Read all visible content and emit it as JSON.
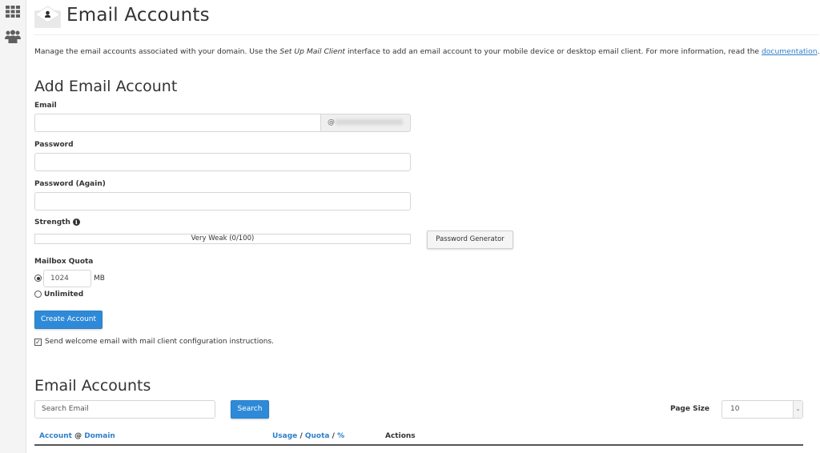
{
  "sidebar": {
    "icons": [
      "apps-grid-icon",
      "users-icon"
    ]
  },
  "header": {
    "icon": "email-envelope-icon",
    "title": "Email Accounts"
  },
  "intro": {
    "before": "Manage the email accounts associated with your domain. Use the ",
    "emphasis": "Set Up Mail Client",
    "after": " interface to add an email account to your mobile device or desktop email client. For more information, read the ",
    "link": "documentation",
    "end": "."
  },
  "add_form": {
    "heading": "Add Email Account",
    "email_label": "Email",
    "email_value": "",
    "domain_prefix": "@",
    "password_label": "Password",
    "password_value": "",
    "password_again_label": "Password (Again)",
    "password_again_value": "",
    "strength_label": "Strength",
    "strength_text": "Very Weak (0/100)",
    "strength_value": 0,
    "password_generator_label": "Password Generator",
    "quota_label": "Mailbox Quota",
    "quota_value": "1024",
    "quota_unit": "MB",
    "quota_unlimited_label": "Unlimited",
    "quota_selected": "limited",
    "create_label": "Create Account",
    "welcome_checked": true,
    "welcome_label": "Send welcome email with mail client configuration instructions."
  },
  "list": {
    "heading": "Email Accounts",
    "search_placeholder": "Search Email",
    "search_label": "Search",
    "page_size_label": "Page Size",
    "page_size_value": "10",
    "columns": {
      "account": "Account",
      "at": "@",
      "domain": "Domain",
      "usage": "Usage",
      "quota": "Quota",
      "percent": "%",
      "slash": "/",
      "actions": "Actions"
    }
  },
  "colors": {
    "primary": "#2e8ad8",
    "link": "#2f7fc8"
  }
}
